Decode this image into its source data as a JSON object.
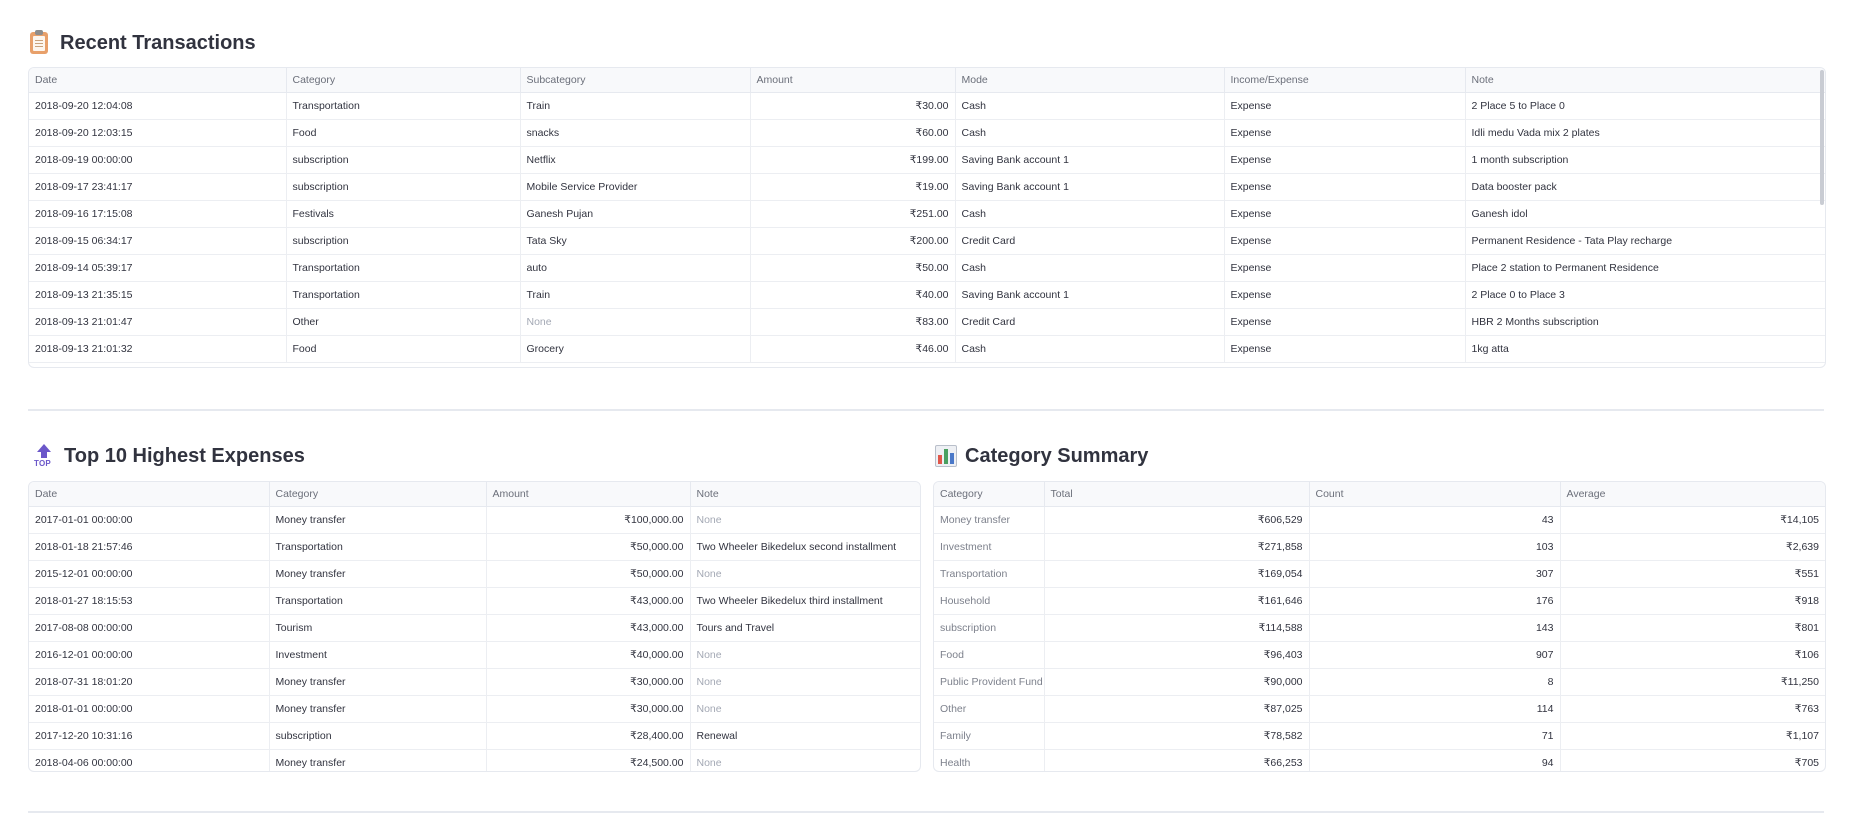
{
  "recent": {
    "title": "Recent Transactions",
    "icon": "clipboard-icon",
    "columns": [
      "Date",
      "Category",
      "Subcategory",
      "Amount",
      "Mode",
      "Income/Expense",
      "Note"
    ],
    "rows": [
      [
        "2018-09-20 12:04:08",
        "Transportation",
        "Train",
        "₹30.00",
        "Cash",
        "Expense",
        "2 Place 5 to Place 0"
      ],
      [
        "2018-09-20 12:03:15",
        "Food",
        "snacks",
        "₹60.00",
        "Cash",
        "Expense",
        "Idli medu Vada mix 2 plates"
      ],
      [
        "2018-09-19 00:00:00",
        "subscription",
        "Netflix",
        "₹199.00",
        "Saving Bank account 1",
        "Expense",
        "1 month subscription"
      ],
      [
        "2018-09-17 23:41:17",
        "subscription",
        "Mobile Service Provider",
        "₹19.00",
        "Saving Bank account 1",
        "Expense",
        "Data booster pack"
      ],
      [
        "2018-09-16 17:15:08",
        "Festivals",
        "Ganesh Pujan",
        "₹251.00",
        "Cash",
        "Expense",
        "Ganesh idol"
      ],
      [
        "2018-09-15 06:34:17",
        "subscription",
        "Tata Sky",
        "₹200.00",
        "Credit Card",
        "Expense",
        "Permanent Residence - Tata Play recharge"
      ],
      [
        "2018-09-14 05:39:17",
        "Transportation",
        "auto",
        "₹50.00",
        "Cash",
        "Expense",
        "Place 2 station to Permanent Residence"
      ],
      [
        "2018-09-13 21:35:15",
        "Transportation",
        "Train",
        "₹40.00",
        "Saving Bank account 1",
        "Expense",
        "2 Place 0 to Place 3"
      ],
      [
        "2018-09-13 21:01:47",
        "Other",
        "None",
        "₹83.00",
        "Credit Card",
        "Expense",
        "HBR 2 Months subscription"
      ],
      [
        "2018-09-13 21:01:32",
        "Food",
        "Grocery",
        "₹46.00",
        "Cash",
        "Expense",
        "1kg atta"
      ]
    ]
  },
  "top10": {
    "title": "Top 10 Highest Expenses",
    "icon": "top-arrow-icon",
    "icon_text": "TOP",
    "columns": [
      "Date",
      "Category",
      "Amount",
      "Note"
    ],
    "rows": [
      [
        "2017-01-01 00:00:00",
        "Money transfer",
        "₹100,000.00",
        "None"
      ],
      [
        "2018-01-18 21:57:46",
        "Transportation",
        "₹50,000.00",
        "Two Wheeler Bikedelux second installment"
      ],
      [
        "2015-12-01 00:00:00",
        "Money transfer",
        "₹50,000.00",
        "None"
      ],
      [
        "2018-01-27 18:15:53",
        "Transportation",
        "₹43,000.00",
        "Two Wheeler Bikedelux third installment"
      ],
      [
        "2017-08-08 00:00:00",
        "Tourism",
        "₹43,000.00",
        "Tours and Travel"
      ],
      [
        "2016-12-01 00:00:00",
        "Investment",
        "₹40,000.00",
        "None"
      ],
      [
        "2018-07-31 18:01:20",
        "Money transfer",
        "₹30,000.00",
        "None"
      ],
      [
        "2018-01-01 00:00:00",
        "Money transfer",
        "₹30,000.00",
        "None"
      ],
      [
        "2017-12-20 10:31:16",
        "subscription",
        "₹28,400.00",
        "Renewal"
      ],
      [
        "2018-04-06 00:00:00",
        "Money transfer",
        "₹24,500.00",
        "None"
      ]
    ]
  },
  "summary": {
    "title": "Category Summary",
    "icon": "bar-chart-icon",
    "columns": [
      "Category",
      "Total",
      "Count",
      "Average"
    ],
    "rows": [
      [
        "Money transfer",
        "₹606,529",
        "43",
        "₹14,105"
      ],
      [
        "Investment",
        "₹271,858",
        "103",
        "₹2,639"
      ],
      [
        "Transportation",
        "₹169,054",
        "307",
        "₹551"
      ],
      [
        "Household",
        "₹161,646",
        "176",
        "₹918"
      ],
      [
        "subscription",
        "₹114,588",
        "143",
        "₹801"
      ],
      [
        "Food",
        "₹96,403",
        "907",
        "₹106"
      ],
      [
        "Public Provident Fund",
        "₹90,000",
        "8",
        "₹11,250"
      ],
      [
        "Other",
        "₹87,025",
        "114",
        "₹763"
      ],
      [
        "Family",
        "₹78,582",
        "71",
        "₹1,107"
      ],
      [
        "Health",
        "₹66,253",
        "94",
        "₹705"
      ]
    ]
  }
}
